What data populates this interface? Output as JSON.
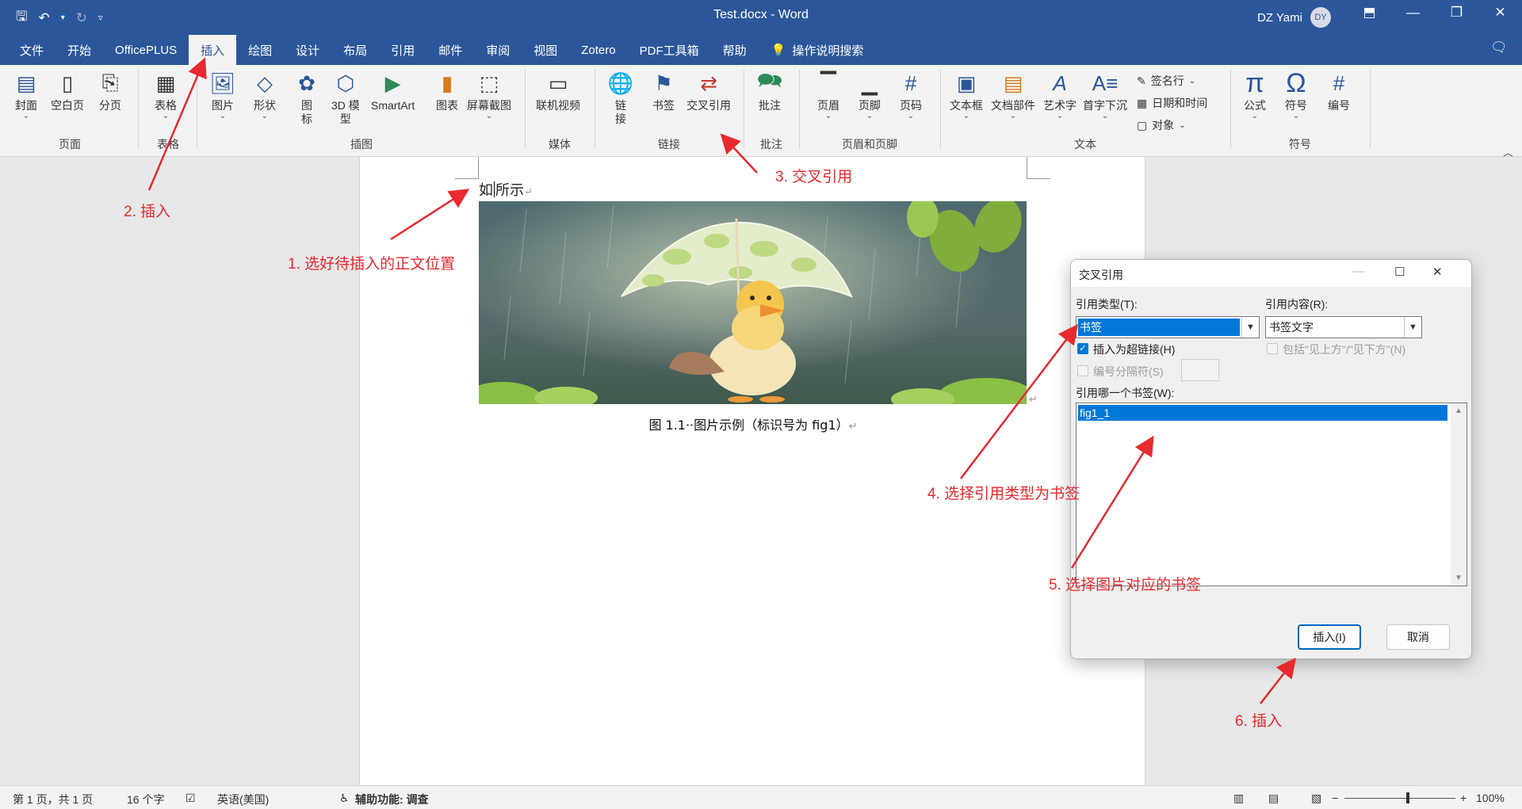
{
  "titlebar": {
    "doc_title": "Test.docx  -  Word",
    "user_name": "DZ Yami",
    "avatar_initials": "DY"
  },
  "tabs": [
    "文件",
    "开始",
    "OfficePLUS",
    "插入",
    "绘图",
    "设计",
    "布局",
    "引用",
    "邮件",
    "审阅",
    "视图",
    "Zotero",
    "PDF工具箱",
    "帮助"
  ],
  "tell_me": "操作说明搜索",
  "ribbon": {
    "groups": {
      "pages": "页面",
      "tables": "表格",
      "illustrations": "插图",
      "media": "媒体",
      "links": "链接",
      "comments": "批注",
      "header_footer": "页眉和页脚",
      "text": "文本",
      "symbols": "符号"
    },
    "buttons": {
      "cover": "封面",
      "blank_page": "空白页",
      "page_break": "分页",
      "table": "表格",
      "picture": "图片",
      "shapes": "形状",
      "icons_l1": "图",
      "icons_l2": "标",
      "model3d_l1": "3D 模",
      "model3d_l2": "型",
      "smartart": "SmartArt",
      "chart": "图表",
      "screenshot": "屏幕截图",
      "online_video": "联机视频",
      "link_l1": "链",
      "link_l2": "接",
      "bookmark": "书签",
      "cross_ref": "交叉引用",
      "comment": "批注",
      "header": "页眉",
      "footer": "页脚",
      "page_number": "页码",
      "textbox": "文本框",
      "quick_parts": "文档部件",
      "wordart": "艺术字",
      "dropcap": "首字下沉",
      "signature": "签名行",
      "datetime": "日期和时间",
      "object": "对象",
      "equation": "公式",
      "symbol": "符号",
      "numbering": "编号"
    }
  },
  "document": {
    "body_text_a": "如",
    "body_text_b": "所示",
    "caption": "图 1.1··图片示例（标识号为 fig1）"
  },
  "annotations": {
    "step1": "1. 选好待插入的正文位置",
    "step2": "2. 插入",
    "step3": "3. 交叉引用",
    "step4": "4. 选择引用类型为书签",
    "step5": "5. 选择图片对应的书签",
    "step6": "6. 插入"
  },
  "dialog": {
    "title": "交叉引用",
    "ref_type_label": "引用类型(T):",
    "ref_type_value": "书签",
    "ref_content_label": "引用内容(R):",
    "ref_content_value": "书签文字",
    "insert_hyperlink_label": "插入为超链接(H)",
    "include_above_below_label": "包括\"见上方\"/\"见下方\"(N)",
    "number_separator_label": "编号分隔符(S)",
    "which_bookmark_label": "引用哪一个书签(W):",
    "bookmarks": [
      "fig1_1"
    ],
    "insert_button": "插入(I)",
    "cancel_button": "取消"
  },
  "statusbar": {
    "page": "第 1 页，共 1 页",
    "words": "16 个字",
    "language": "英语(美国)",
    "accessibility": "辅助功能: 调查",
    "zoom": "100%"
  },
  "colors": {
    "titlebar": "#2b579a",
    "annotation": "#e8292e",
    "selection": "#0078d7"
  }
}
